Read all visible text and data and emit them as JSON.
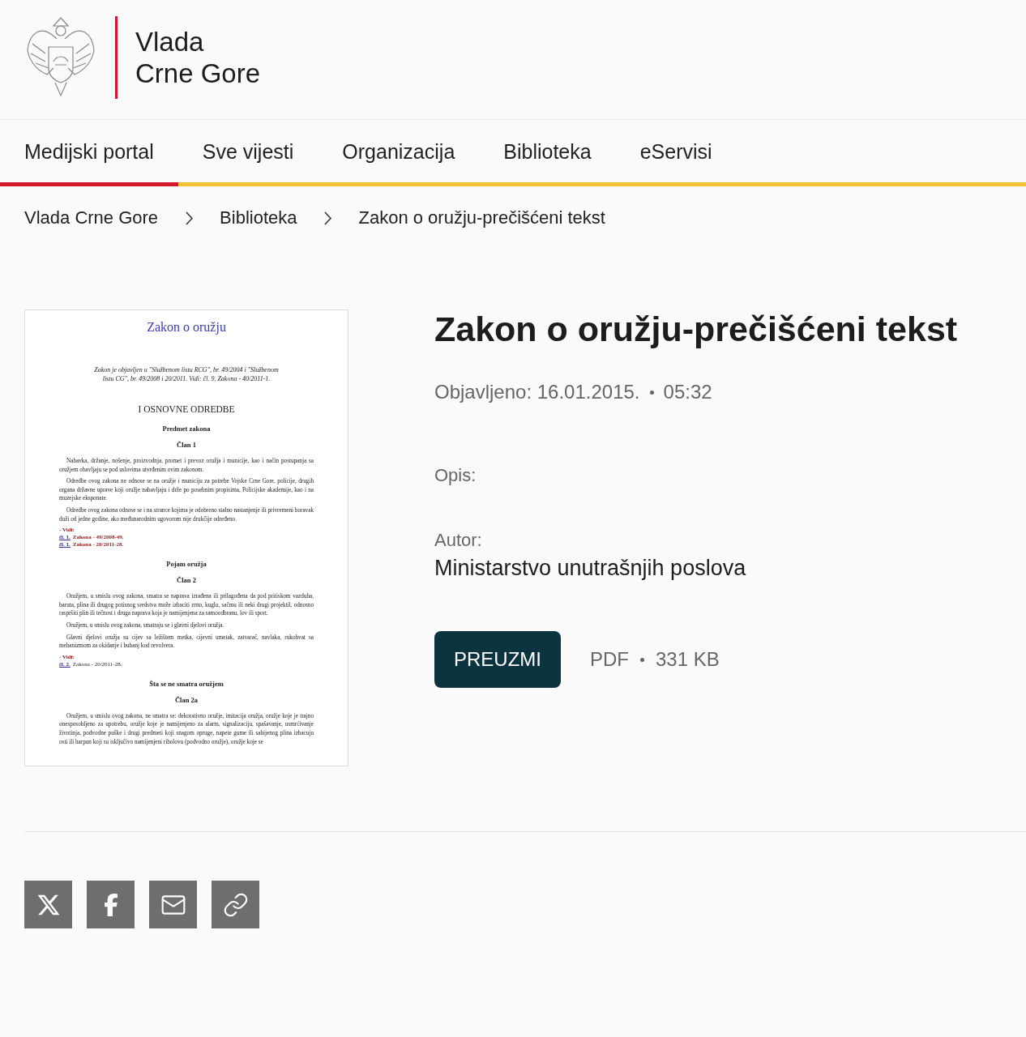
{
  "header": {
    "logo_lines": [
      "Vlada",
      "Crne Gore"
    ]
  },
  "nav": [
    {
      "label": "Medijski portal",
      "selected": true
    },
    {
      "label": "Sve vijesti",
      "selected": false
    },
    {
      "label": "Organizacija",
      "selected": false
    },
    {
      "label": "Biblioteka",
      "selected": false
    },
    {
      "label": "eServisi",
      "selected": false
    }
  ],
  "breadcrumbs": [
    "Vlada Crne Gore",
    "Biblioteka",
    "Zakon o oružju-prečišćeni tekst"
  ],
  "document_preview": [
    {
      "kind": "title",
      "text": "Zakon o oružju"
    },
    {
      "kind": "note",
      "text": "Zakon je objavljen u \"Službenom listu RCG\", br. 49/2004 i \"Službenom listu CG\", br. 49/2008 i 20/2011. Vidi: čl. 9. Zakona - 40/2011-1."
    },
    {
      "kind": "heading",
      "text": "I OSNOVNE ODREDBE"
    },
    {
      "kind": "subheading",
      "text": "Predmet zakona"
    },
    {
      "kind": "subheading",
      "text": "Član 1"
    },
    {
      "kind": "paragraph",
      "text": "Nabavka, držanje, nošenje, proizvodnja, promet i prevoz oružja i municije, kao i način postupanja sa oružjem obavljaju se pod uslovima utvrđenim ovim zakonom."
    },
    {
      "kind": "paragraph",
      "text": "Odredbe ovog zakona ne odnose se na oružje i municiju za potrebe Vojske Crne Gore, policije, drugih organa državne uprave koji oružje nabavljaju i drže po posebnim propisima, Policijske akademije, kao i na muzejske eksponate."
    },
    {
      "kind": "paragraph",
      "text": "Odredbe ovog zakona odnose se i na strance kojima je odobreno stalno nastanjenje ili privremeni boravak duži od jedne godine, ako međunarodnim ugovorom nije drukčije određeno."
    },
    {
      "kind": "see",
      "text": "- Vidi:"
    },
    {
      "kind": "ref",
      "link": "čl. 1.",
      "text": "Zakona - 49/2008-49.",
      "emphasis": true
    },
    {
      "kind": "ref",
      "link": "čl. 1.",
      "text": "Zakona - 20/2011-28.",
      "emphasis": true
    },
    {
      "kind": "subheading",
      "text": "Pojam oružja"
    },
    {
      "kind": "subheading",
      "text": "Član 2"
    },
    {
      "kind": "paragraph",
      "text": "Oružjem, u smislu ovog zakona, smatra se naprava izrađena ili prilagođena da pod pritiskom vazduha, baruta, plina ili drugog potisnog sredstva može izbaciti zrno, kuglu, sačmu ili neki drugi projektil, odnosno raspršiti plin ili tečnost i druga naprava koja je namijenjena za samoodbranu, lov ili sport."
    },
    {
      "kind": "paragraph",
      "text": "Oružjem, u smislu ovog zakona, smatraju se i glavni djelovi oružja."
    },
    {
      "kind": "paragraph",
      "text": "Glavni djelovi oružja su cijev sa ležištem metka, cijevni umetak, zatvarač, navlaka, rukohvat sa mehanizmom za okidanje i bubanj kod revolvera."
    },
    {
      "kind": "see",
      "text": "- Vidi:"
    },
    {
      "kind": "ref",
      "link": "čl. 2.",
      "text": "Zakona - 20/2011-28.",
      "emphasis": false
    },
    {
      "kind": "subheading",
      "text": "Šta se ne smatra oružjem"
    },
    {
      "kind": "subheading",
      "text": "Član 2a"
    },
    {
      "kind": "paragraph",
      "text": "Oružjem, u smislu ovog zakona, ne smatra se: dekorativno oružje, imitacija oružja, oružje koje je trajno onesposobljeno za upotrebu, oružje koje je namijenjeno za alarm, signalizaciju, spašavanje, usmrćivanje životinja, podvodne puške i drugi predmeti koji snagom opruge, napete gume ili sabijenog plina izbacuju osti ili harpun koji su isključivo namijenjeni ribolovu (podvodno oružje), oružje koje se"
    }
  ],
  "title": "Zakon o oružju-prečišćeni tekst",
  "published": {
    "label": "Objavljeno: 16.01.2015.",
    "time": "05:32"
  },
  "description_label": "Opis:",
  "author": {
    "label": "Autor:",
    "value": "Ministarstvo unutrašnjih poslova"
  },
  "download": {
    "button": "PREUZMI",
    "format": "PDF",
    "size": "331 KB"
  },
  "share": [
    {
      "kind": "x"
    },
    {
      "kind": "facebook"
    },
    {
      "kind": "email"
    },
    {
      "kind": "link"
    }
  ]
}
